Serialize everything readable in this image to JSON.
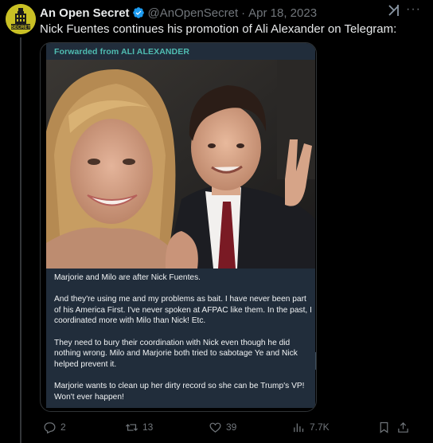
{
  "tweet": {
    "author_name": "An Open Secret",
    "handle": "@AnOpenSecret",
    "separator": "·",
    "date": "Apr 18, 2023",
    "text": "Nick Fuentes continues his promotion of Ali Alexander on Telegram:",
    "avatar_icon": "building-logo-icon",
    "avatar_text": "SECRET",
    "colors": {
      "background": "#000000",
      "verified": "#1d9bf0",
      "muted": "#71767b",
      "telegram_card": "#212d3b",
      "forward_label": "#4fbcb1"
    }
  },
  "telegram": {
    "forwarded_label": "Forwarded from ALI ALEXANDER",
    "paragraphs": [
      "Marjorie and Milo are after Nick Fuentes.",
      "And they're using me and my problems as bait. I have never been part of his America First. I've never spoken at AFPAC like them. In the past, I coordinated more with Milo than Nick! Etc.",
      "They need to bury their coordination with Nick even though he did nothing wrong. Milo and Marjorie both tried to sabotage Ye and Nick helped prevent it.",
      "Marjorie wants to clean up her dirty record so she can be Trump's VP! Won't ever happen!"
    ]
  },
  "actions": {
    "replies": "2",
    "reposts": "13",
    "likes": "39",
    "views": "7.7K"
  }
}
